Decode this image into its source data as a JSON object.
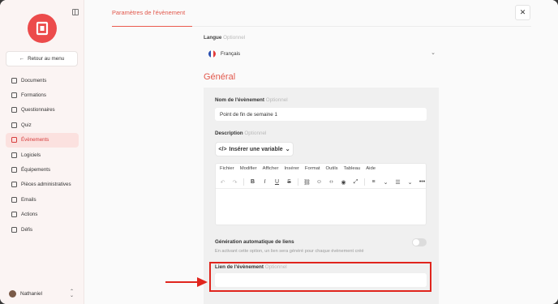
{
  "sidebar": {
    "back_label": "Retour au menu",
    "items": [
      {
        "label": "Documents",
        "icon": "document-icon",
        "active": false
      },
      {
        "label": "Formations",
        "icon": "book-icon",
        "active": false
      },
      {
        "label": "Questionnaires",
        "icon": "question-icon",
        "active": false
      },
      {
        "label": "Quiz",
        "icon": "chat-icon",
        "active": false
      },
      {
        "label": "Évènements",
        "icon": "people-icon",
        "active": true
      },
      {
        "label": "Logiciels",
        "icon": "mouse-icon",
        "active": false
      },
      {
        "label": "Équipements",
        "icon": "monitor-icon",
        "active": false
      },
      {
        "label": "Pièces administratives",
        "icon": "id-card-icon",
        "active": false
      },
      {
        "label": "Emails",
        "icon": "mail-icon",
        "active": false
      },
      {
        "label": "Actions",
        "icon": "list-icon",
        "active": false
      },
      {
        "label": "Défis",
        "icon": "car-icon",
        "active": false
      }
    ],
    "user_name": "Nathaniel"
  },
  "header": {
    "tab_label": "Paramètres de l'évènement",
    "close_symbol": "✕"
  },
  "form": {
    "langue_label": "Langue",
    "optional_tag": "Optionnel",
    "langue_value": "Français",
    "section_title": "Général",
    "nom_label": "Nom de l'évènement",
    "nom_value": "Point de fin de semaine 1",
    "description_label": "Description",
    "insert_variable_label": "Insérer une variable",
    "editor_menu": [
      "Fichier",
      "Modifier",
      "Afficher",
      "Insérer",
      "Format",
      "Outils",
      "Tableau",
      "Aide"
    ],
    "generation_label": "Génération automatique de liens",
    "generation_desc": "En activant cette option, un lien sera généré pour chaque évènement créé",
    "generation_enabled": false,
    "lien_label": "Lien de l'évènement",
    "lien_value": ""
  },
  "colors": {
    "accent": "#e2584c",
    "highlight": "#e0251d",
    "active_bg": "#fbe1df"
  }
}
